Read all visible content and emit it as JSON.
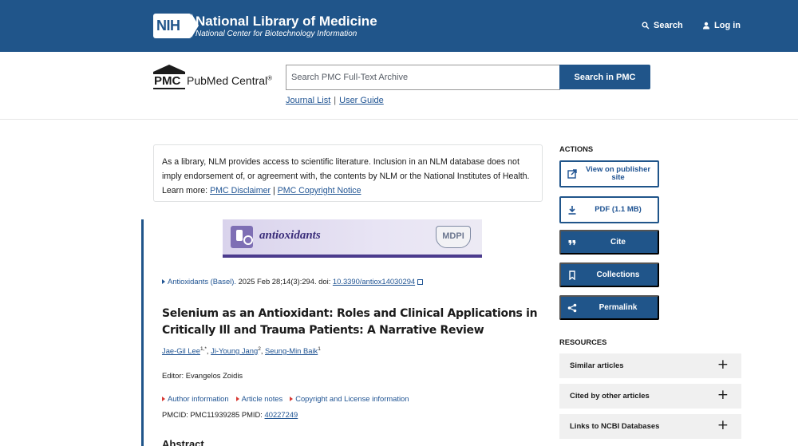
{
  "header": {
    "logo_text": "NIH",
    "org_title": "National Library of Medicine",
    "org_subtitle": "National Center for Biotechnology Information",
    "search_label": "Search",
    "login_label": "Log in"
  },
  "pmc": {
    "logo_abbrev": "PMC",
    "logo_name": "PubMed Central",
    "logo_reg": "®",
    "search_placeholder": "Search PMC Full-Text Archive",
    "search_button": "Search in PMC",
    "journal_list": "Journal List",
    "separator": "|",
    "user_guide": "User Guide"
  },
  "disclaimer": {
    "text": "As a library, NLM provides access to scientific literature. Inclusion in an NLM database does not imply endorsement of, or agreement with, the contents by NLM or the National Institutes of Health.",
    "learn_more": "Learn more:",
    "link1": "PMC Disclaimer",
    "sep": "|",
    "link2": "PMC Copyright Notice"
  },
  "article": {
    "journal_banner_name": "antioxidants",
    "publisher_logo": "MDPI",
    "journal_link": "Antioxidants (Basel).",
    "citation_rest": " 2025 Feb 28;14(3):294. doi: ",
    "doi": "10.3390/antiox14030294",
    "title": "Selenium as an Antioxidant: Roles and Clinical Applications in Critically Ill and Trauma Patients: A Narrative Review",
    "authors": [
      {
        "name": "Jae-Gil Lee",
        "sup": "1,*"
      },
      {
        "name": "Ji-Young Jang",
        "sup": "2"
      },
      {
        "name": "Seung-Min Baik",
        "sup": "1"
      }
    ],
    "editor": "Editor: Evangelos Zoidis",
    "info_links": [
      "Author information",
      "Article notes",
      "Copyright and License information"
    ],
    "pmcid_label": "PMCID: PMC11939285  PMID: ",
    "pmid": "40227249",
    "abstract_heading": "Abstract"
  },
  "sidebar": {
    "actions_heading": "ACTIONS",
    "actions": [
      {
        "label": "View on publisher site",
        "icon": "external-link-icon"
      },
      {
        "label": "PDF (1.1 MB)",
        "icon": "download-icon"
      },
      {
        "label": "Cite",
        "icon": "quote-icon"
      },
      {
        "label": "Collections",
        "icon": "bookmark-icon"
      },
      {
        "label": "Permalink",
        "icon": "share-icon"
      }
    ],
    "resources_heading": "RESOURCES",
    "resources": [
      {
        "label": "Similar articles",
        "icon": "plus-icon"
      },
      {
        "label": "Cited by other articles",
        "icon": "plus-icon"
      },
      {
        "label": "Links to NCBI Databases",
        "icon": "plus-icon"
      }
    ],
    "plus_glyph": "+"
  },
  "colors": {
    "brand_blue": "#20558a",
    "link_blue": "#205493",
    "accent_red": "#d83933"
  }
}
